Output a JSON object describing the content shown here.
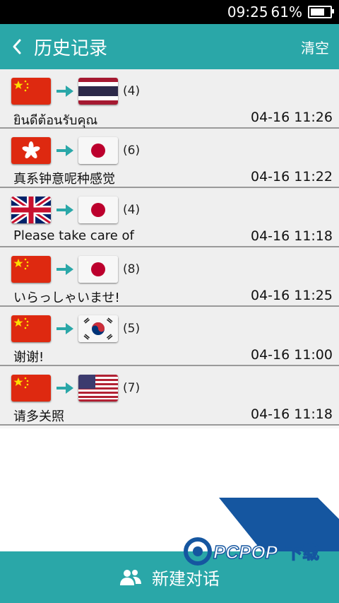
{
  "status_bar": {
    "time": "09:25",
    "battery": "61%"
  },
  "header": {
    "title": "历史记录",
    "clear_label": "清空"
  },
  "history": [
    {
      "from": "cn",
      "to": "th",
      "count": "(4)",
      "phrase": "ยินดีต้อนรับคุณ",
      "time": "04-16 11:26"
    },
    {
      "from": "hk",
      "to": "jp",
      "count": "(6)",
      "phrase": "真系钟意呢种感觉",
      "time": "04-16 11:22"
    },
    {
      "from": "gb",
      "to": "jp",
      "count": "(4)",
      "phrase": "Please take care of",
      "time": "04-16 11:18"
    },
    {
      "from": "cn",
      "to": "jp",
      "count": "(8)",
      "phrase": "いらっしゃいませ!",
      "time": "04-16 11:25"
    },
    {
      "from": "cn",
      "to": "kr",
      "count": "(5)",
      "phrase": "谢谢!",
      "time": "04-16 11:00"
    },
    {
      "from": "cn",
      "to": "us",
      "count": "(7)",
      "phrase": "请多关照",
      "time": "04-16 11:18"
    }
  ],
  "footer": {
    "new_conversation_label": "新建对话"
  },
  "watermark": {
    "logo": "PCPOP",
    "text": "下载"
  },
  "colors": {
    "accent": "#2aa7a8",
    "watermark_blue": "#1556a0"
  }
}
